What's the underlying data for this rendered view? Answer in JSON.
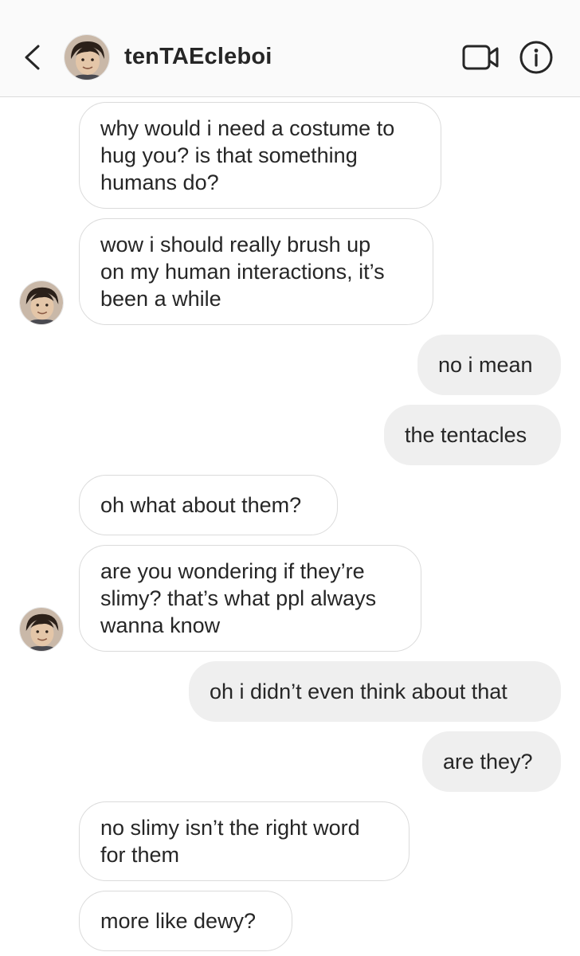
{
  "header": {
    "username": "tenTAEcleboi",
    "back_icon": "chevron-left-icon",
    "video_icon": "video-camera-icon",
    "info_icon": "info-icon"
  },
  "messages": [
    {
      "from": "them",
      "text": "why would i need a costume to\nhug you? is that something\nhumans do?"
    },
    {
      "from": "them",
      "text": "wow i should really brush up\non my human interactions, it’s\nbeen a while"
    },
    {
      "from": "me",
      "text": "no i mean"
    },
    {
      "from": "me",
      "text": "the tentacles"
    },
    {
      "from": "them",
      "text": "oh what about them?"
    },
    {
      "from": "them",
      "text": "are you wondering if they’re\nslimy? that’s what ppl always\nwanna know"
    },
    {
      "from": "me",
      "text": "oh i didn’t even think about that"
    },
    {
      "from": "me",
      "text": "are they?"
    },
    {
      "from": "them",
      "text": "no slimy isn’t the right word\nfor them"
    },
    {
      "from": "them",
      "text": "more like dewy?"
    }
  ],
  "colors": {
    "incoming_bg": "#ffffff",
    "incoming_border": "#dbdbdb",
    "outgoing_bg": "#efefef",
    "text": "#262626",
    "header_bg": "#fafafa"
  }
}
